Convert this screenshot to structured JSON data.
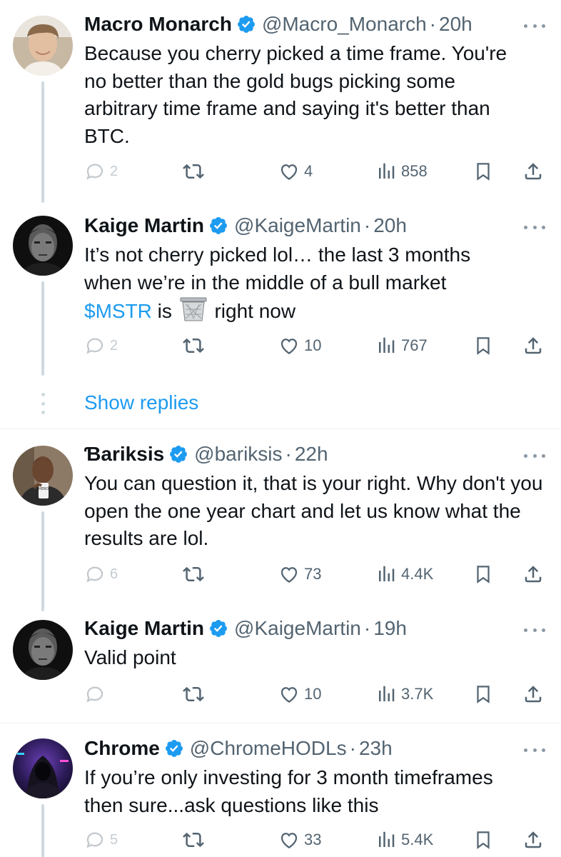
{
  "tweets": [
    {
      "name": "Macro Monarch",
      "handle": "@Macro_Monarch",
      "time": "20h",
      "text": "Because you cherry picked a time frame. You're no better than the gold bugs picking some arbitrary time frame and saying it's better than BTC.",
      "replies": "2",
      "likes": "4",
      "views": "858",
      "avatar": "young-man-photo"
    },
    {
      "name": "Kaige Martin",
      "handle": "@KaigeMartin",
      "time": "20h",
      "text_line1": "It’s not cherry picked lol… the last 3 months",
      "text_line2": "when we’re in the middle of a bull market",
      "cashtag": "$MSTR",
      "text_after_cashtag": " is ",
      "emoji": "wastebasket-emoji",
      "text_end": " right now",
      "replies": "2",
      "likes": "10",
      "views": "767",
      "avatar": "dark-portrait"
    },
    {
      "name": "Ɓariksis",
      "handle": "@bariksis",
      "time": "22h",
      "text": "You can question it, that is your right. Why don't you open the one year chart and let us know what the results are lol.",
      "replies": "6",
      "likes": "73",
      "views": "4.4K",
      "avatar": "man-with-cup-photo"
    },
    {
      "name": "Kaige Martin",
      "handle": "@KaigeMartin",
      "time": "19h",
      "text": "Valid point",
      "replies": "",
      "likes": "10",
      "views": "3.7K",
      "avatar": "dark-portrait"
    },
    {
      "name": "Chrome",
      "handle": "@ChromeHODLs",
      "time": "23h",
      "text": "If you’re only investing for 3 month timeframes then sure...ask questions like this",
      "replies": "5",
      "likes": "33",
      "views": "5.4K",
      "avatar": "hooded-figure-neon"
    }
  ],
  "thread": {
    "show_replies_label": "Show replies"
  },
  "colors": {
    "accent": "#1d9bf0",
    "text": "#0f1419",
    "secondary": "#536471",
    "line": "#cfd9de"
  }
}
